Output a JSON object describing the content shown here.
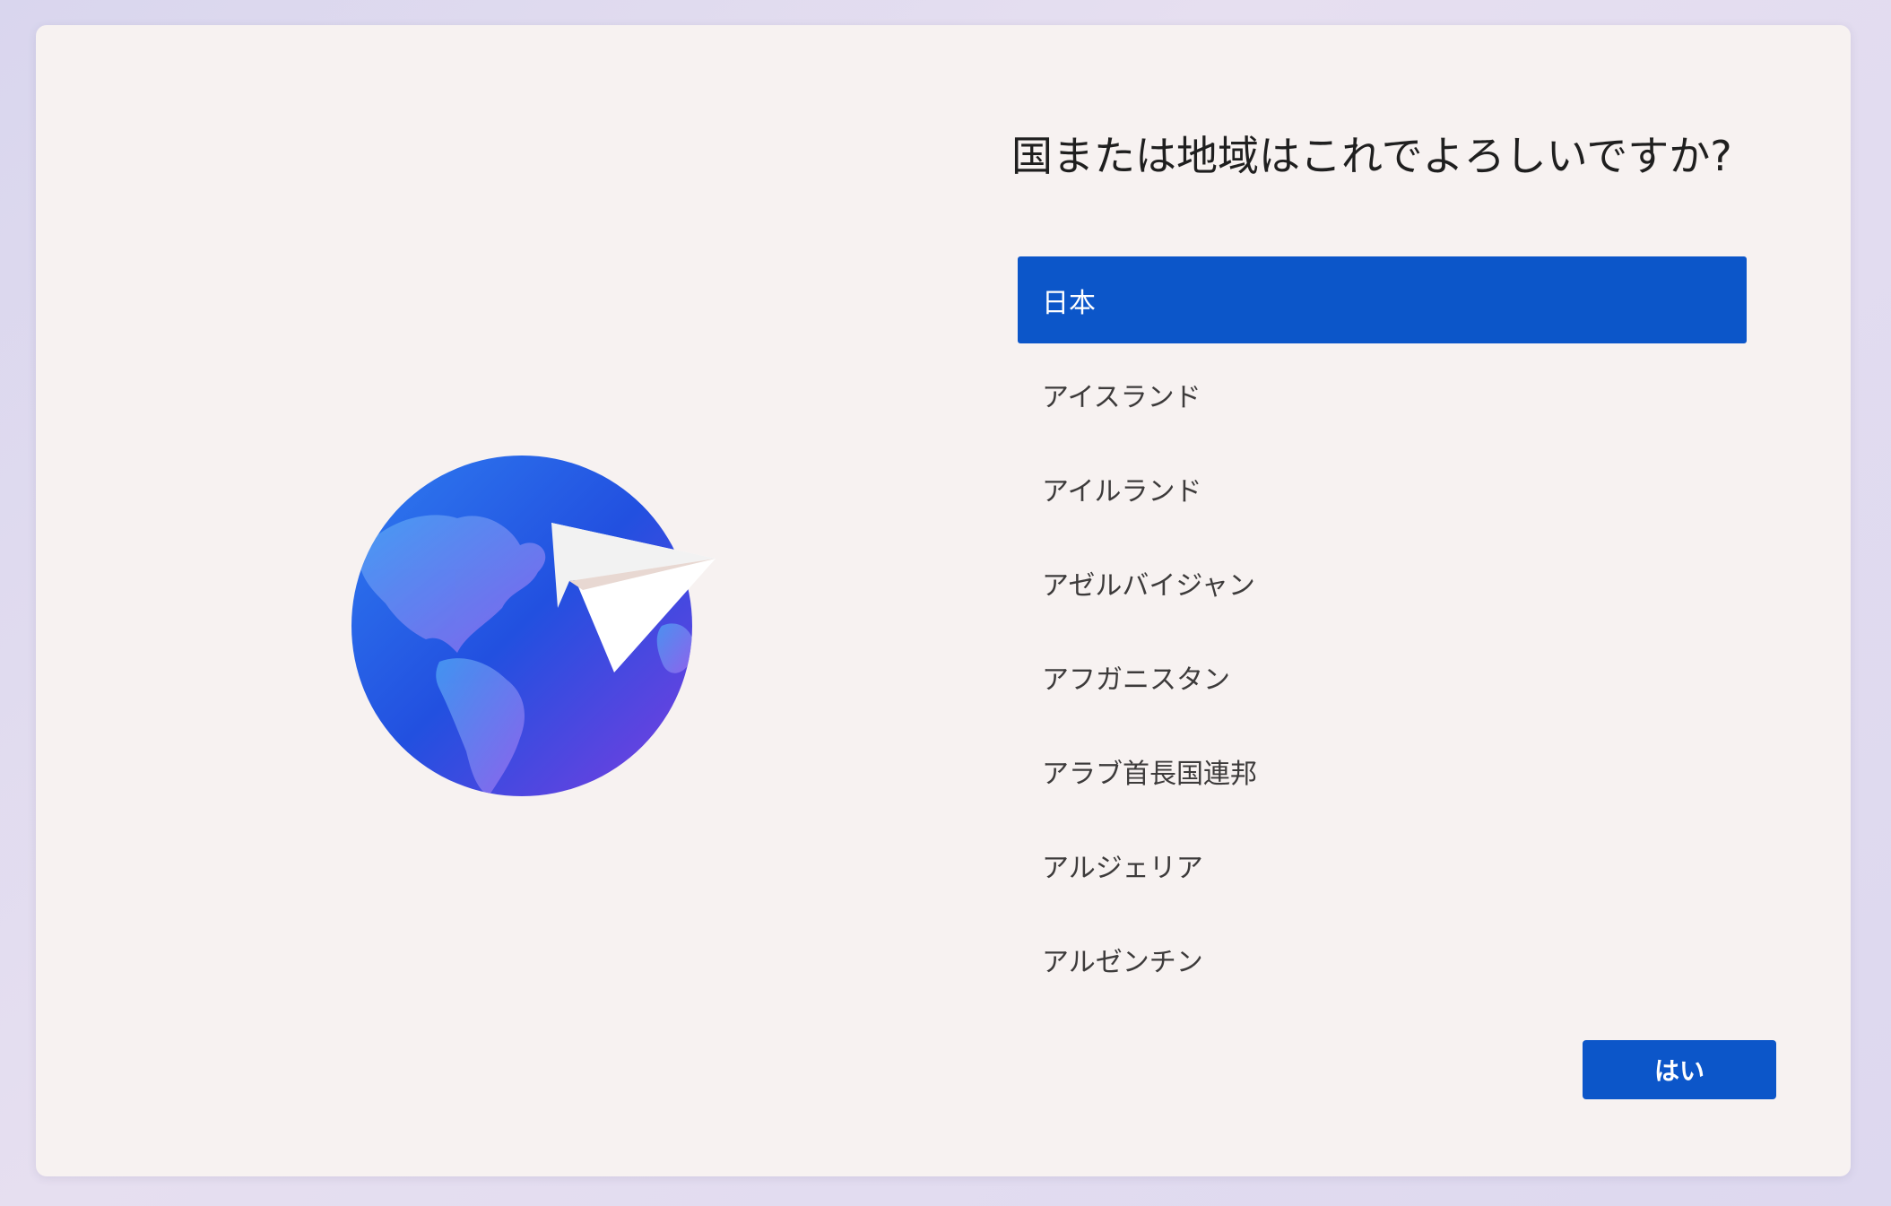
{
  "setup": {
    "title": "国または地域はこれでよろしいですか?",
    "regions": [
      {
        "label": "日本",
        "selected": true
      },
      {
        "label": "アイスランド",
        "selected": false
      },
      {
        "label": "アイルランド",
        "selected": false
      },
      {
        "label": "アゼルバイジャン",
        "selected": false
      },
      {
        "label": "アフガニスタン",
        "selected": false
      },
      {
        "label": "アラブ首長国連邦",
        "selected": false
      },
      {
        "label": "アルジェリア",
        "selected": false
      },
      {
        "label": "アルゼンチン",
        "selected": false
      }
    ],
    "yes_label": "はい",
    "illustration_icon": "globe-with-paper-plane-icon"
  },
  "colors": {
    "accent": "#0c56c9",
    "window_background": "#f7f2f1",
    "globe_blue": "#2f5fe0",
    "globe_purple": "#7a43e0"
  }
}
